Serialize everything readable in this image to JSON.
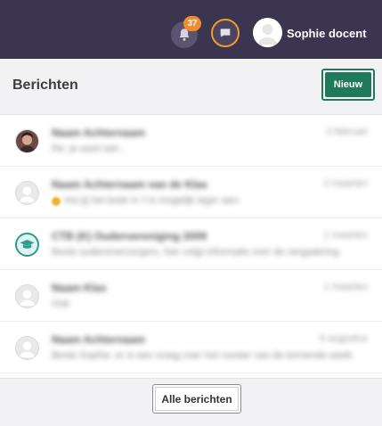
{
  "topbar": {
    "notifications_badge": "37",
    "user_name": "Sophie docent"
  },
  "header": {
    "title": "Berichten",
    "new_label": "Nieuw"
  },
  "messages": [
    {
      "name": "Naam Achternaam",
      "time": "3 februari",
      "preview": "Re: je weet wel..."
    },
    {
      "name": "Naam Achternaam van de Klas",
      "time": "2 maarten",
      "preview": "Hoi jij het boek in 't is mogelijk lager aan."
    },
    {
      "name": "CTB (K) Oudervereniging 2009",
      "time": "1 maarten",
      "preview": "Beste ouders/verzorgers, hier volgt informatie over de vergadering"
    },
    {
      "name": "Naam Klas",
      "time": "1 maarten",
      "preview": "Ook"
    },
    {
      "name": "Naam Achternaam",
      "time": "8 augustus",
      "preview": "Beste Sophie, er is een vraag over het rooster van de komende week"
    }
  ],
  "footer": {
    "all_label": "Alle berichten"
  },
  "colors": {
    "topbar": "#3b3550",
    "badge": "#f28b2e",
    "accent_green": "#1f7a5a",
    "active_ring": "#f29a2e"
  }
}
